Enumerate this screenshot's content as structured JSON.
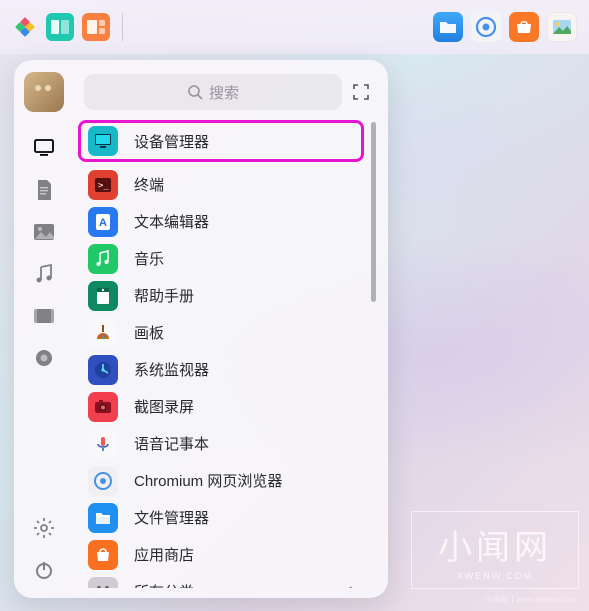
{
  "search": {
    "placeholder": "搜索"
  },
  "apps": [
    {
      "label": "设备管理器",
      "icon": "device-manager",
      "bg": "#18b8c8",
      "highlight": true
    },
    {
      "label": "终端",
      "icon": "terminal",
      "bg": "#e04030"
    },
    {
      "label": "文本编辑器",
      "icon": "text-editor",
      "bg": "#2878f0"
    },
    {
      "label": "音乐",
      "icon": "music",
      "bg": "#20c868"
    },
    {
      "label": "帮助手册",
      "icon": "help",
      "bg": "#108860"
    },
    {
      "label": "画板",
      "icon": "paint",
      "bg": "#f8f8f8"
    },
    {
      "label": "系统监视器",
      "icon": "monitor",
      "bg": "#3050c0"
    },
    {
      "label": "截图录屏",
      "icon": "screenshot",
      "bg": "#f04050"
    },
    {
      "label": "语音记事本",
      "icon": "voice",
      "bg": "#f8f8f8"
    },
    {
      "label": "Chromium 网页浏览器",
      "icon": "chromium",
      "bg": "#f0f0f2"
    },
    {
      "label": "文件管理器",
      "icon": "files",
      "bg": "#2090f0"
    },
    {
      "label": "应用商店",
      "icon": "store",
      "bg": "#f87020"
    },
    {
      "label": "所有分类",
      "icon": "all",
      "bg": "#d0ccd4"
    }
  ],
  "watermark": {
    "main": "小闻网",
    "sub": "XWENW.COM",
    "tag": "小闻网丨www.xwenw.com"
  }
}
